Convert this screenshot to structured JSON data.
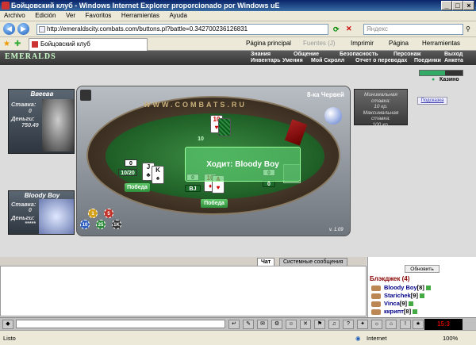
{
  "window": {
    "title": "Бойцовский клуб - Windows Internet Explorer proporcionado por Windows uE",
    "buttons": [
      "_",
      "□",
      "×"
    ]
  },
  "menu": [
    "Archivo",
    "Edición",
    "Ver",
    "Favoritos",
    "Herramientas",
    "Ayuda"
  ],
  "address": {
    "url": "http://emeraldscity.combats.com/buttons.pl?battle=0.342700236126831",
    "search_placeholder": "Яндекс"
  },
  "tabs": {
    "active_tab": "Бойцовский клуб",
    "commands": [
      "Página principal",
      "Fuentes (J)",
      "Imprimir",
      "Página",
      "Herramientas"
    ]
  },
  "game_nav": {
    "logo": "EMERALDS",
    "top": [
      "Знания",
      "Общение",
      "Безопасность",
      "Персонаж",
      "Выход"
    ],
    "sub": [
      "Инвентарь",
      "Умения",
      "Мой Скролл",
      "Отчет о переводах",
      "Поединки",
      "Анкета"
    ],
    "casino_label": "Казино"
  },
  "players": [
    {
      "name": "Ввеевв",
      "bet_label": "Ставка:",
      "bet": "0",
      "money_label": "Деньги:",
      "money": "750.49"
    },
    {
      "name": "Bloody Boy",
      "bet_label": "Ставка:",
      "bet": "0",
      "money_label": "Деньги:",
      "money": "*****"
    }
  ],
  "table": {
    "site_text": "WWW.COMBATS.RU",
    "round_label": "8-ка Червей",
    "version": "v. 1.09",
    "turn_text": "Ходит: Bloody Boy",
    "dealer_score": "10",
    "scores": {
      "p1_top": "0",
      "p1_main": "10/20",
      "center_top": "0",
      "center": "BJ",
      "right_top": "0",
      "right": "0"
    },
    "win_labels": [
      "Победа",
      "Победа"
    ],
    "chips": [
      "1",
      "5",
      "10",
      "25",
      "1K"
    ],
    "chip_colors": [
      "#d4a018",
      "#c0342b",
      "#3060c0",
      "#2a8a3a",
      "#333333"
    ]
  },
  "info": {
    "min_label": "Минимальная ставка:",
    "min_val": "10 кр.",
    "max_label": "Максимальная ставка:",
    "max_val": "100 кр.",
    "help": "Подсказка"
  },
  "chat": {
    "tabs": [
      "Чат",
      "Системные сообщения"
    ]
  },
  "userlist": {
    "refresh": "Обновить",
    "room": "Блэкджек (4)",
    "users": [
      {
        "name": "Bloody Boy",
        "level": "[8]"
      },
      {
        "name": "Starichek",
        "level": "[9]"
      },
      {
        "name": "Vinca",
        "level": "[9]"
      },
      {
        "name": "ккрипт",
        "level": "[8]"
      }
    ]
  },
  "bottom": {
    "clock": "15:3",
    "icons": [
      "↵",
      "✎",
      "✉",
      "⚙",
      "☺",
      "✕",
      "⚑",
      "♫",
      "?",
      "✦",
      "☼",
      "⌂",
      "!",
      "★"
    ]
  },
  "status": {
    "left": "Listo",
    "zone": "Internet",
    "zoom": "100%"
  }
}
